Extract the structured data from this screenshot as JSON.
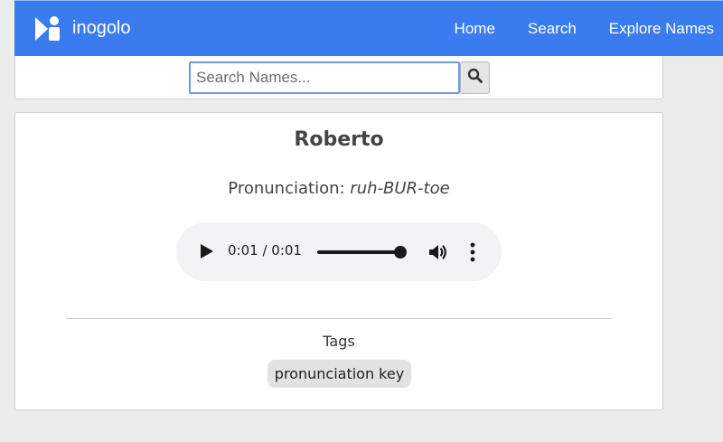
{
  "nav": {
    "brand": "inogolo",
    "links": [
      "Home",
      "Search",
      "Explore Names"
    ]
  },
  "search": {
    "placeholder": "Search Names...",
    "value": ""
  },
  "name_card": {
    "name": "Roberto",
    "pronunciation_label": "Pronunciation:",
    "pronunciation_value": "ruh-BUR-toe",
    "audio": {
      "current_time": "0:01",
      "duration": "0:01",
      "time_display": "0:01 / 0:01",
      "progress": 1.0
    },
    "tags_label": "Tags",
    "tags": [
      "pronunciation key"
    ]
  },
  "colors": {
    "nav_bg": "#3a7cf0",
    "page_bg": "#ececec",
    "accent_border": "#6d9ae6"
  },
  "icons": {
    "logo": "inogolo-logo-icon",
    "search": "search-icon",
    "play": "play-icon",
    "volume": "volume-icon",
    "more": "more-vertical-icon"
  }
}
